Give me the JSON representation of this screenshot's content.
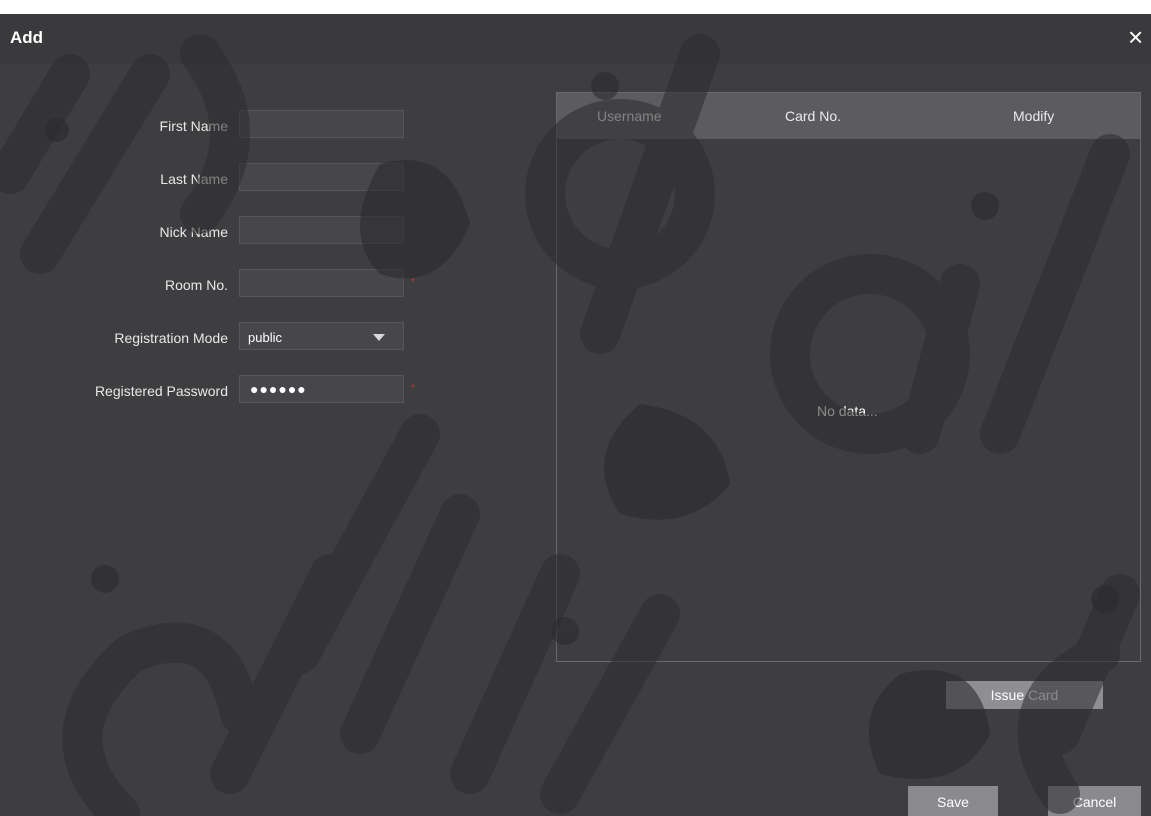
{
  "dialog": {
    "title": "Add",
    "close_symbol": "×"
  },
  "form": {
    "first_name": {
      "label": "First Name",
      "value": ""
    },
    "last_name": {
      "label": "Last Name",
      "value": ""
    },
    "nick_name": {
      "label": "Nick Name",
      "value": ""
    },
    "room_no": {
      "label": "Room No.",
      "value": "",
      "required_mark": "*"
    },
    "registration_mode": {
      "label": "Registration Mode",
      "selected": "public"
    },
    "registered_password": {
      "label": "Registered Password",
      "masked_value": "●●●●●●",
      "required_mark": "*"
    }
  },
  "table": {
    "columns": [
      "Username",
      "Card No.",
      "Modify"
    ],
    "empty_text": "No data..."
  },
  "buttons": {
    "issue_card": "Issue Card",
    "save": "Save",
    "cancel": "Cancel"
  },
  "watermark": {
    "text": "digitklik"
  },
  "colors": {
    "dialog_bg": "#3e3e40",
    "table_header_bg": "#5c5c60",
    "button_bg": "#8a8a8e",
    "required": "#c0392b"
  }
}
